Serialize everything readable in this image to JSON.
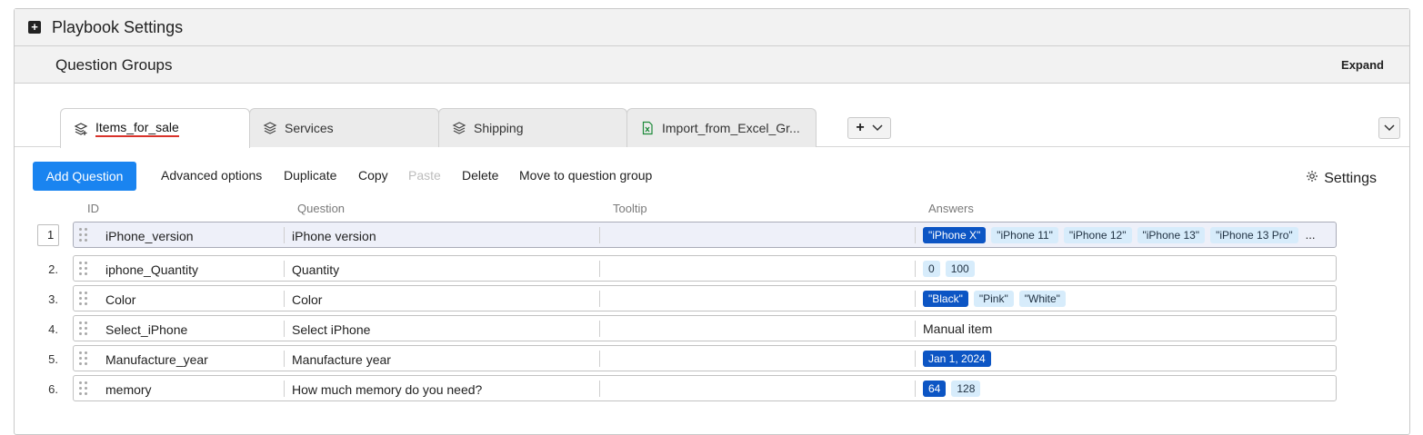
{
  "panel": {
    "title": "Playbook Settings",
    "toggle_glyph": "+"
  },
  "question_groups": {
    "title": "Question Groups",
    "expand_label": "Expand"
  },
  "tabs": [
    {
      "label": "Items_for_sale",
      "icon": "layers-edit-icon",
      "active": true
    },
    {
      "label": "Services",
      "icon": "layers-icon",
      "active": false
    },
    {
      "label": "Shipping",
      "icon": "layers-icon",
      "active": false
    },
    {
      "label": "Import_from_Excel_Gr...",
      "icon": "excel-file-icon",
      "active": false
    }
  ],
  "tab_add": {
    "plus": "+",
    "icon": "chevron-down-icon"
  },
  "toolbar": {
    "add_question": "Add Question",
    "advanced_options": "Advanced options",
    "duplicate": "Duplicate",
    "copy": "Copy",
    "paste": "Paste",
    "delete": "Delete",
    "move": "Move to question group",
    "settings": "Settings"
  },
  "columns": {
    "id": "ID",
    "question": "Question",
    "tooltip": "Tooltip",
    "answers": "Answers"
  },
  "rows": [
    {
      "num": "1",
      "id": "iPhone_version",
      "question": "iPhone version",
      "tooltip": "",
      "answers": [
        "\"iPhone X\"",
        "\"iPhone 11\"",
        "\"iPhone 12\"",
        "\"iPhone 13\"",
        "\"iPhone 13 Pro\""
      ],
      "more": "...",
      "selected": true
    },
    {
      "num": "2.",
      "id": "iphone_Quantity",
      "question": "Quantity",
      "tooltip": "",
      "answers": [
        "0",
        "100"
      ]
    },
    {
      "num": "3.",
      "id": "Color",
      "question": "Color",
      "tooltip": "",
      "answers": [
        "\"Black\"",
        "\"Pink\"",
        "\"White\""
      ]
    },
    {
      "num": "4.",
      "id": "Select_iPhone",
      "question": "Select iPhone",
      "tooltip": "",
      "answer_text": "Manual item"
    },
    {
      "num": "5.",
      "id": "Manufacture_year",
      "question": "Manufacture year",
      "tooltip": "",
      "answers": [
        "Jan 1, 2024"
      ]
    },
    {
      "num": "6.",
      "id": "memory",
      "question": "How much memory do you need?",
      "tooltip": "",
      "answers": [
        "64",
        "128"
      ]
    }
  ],
  "colors": {
    "primary": "#1a84f0",
    "chip_dark": "#0c55c4",
    "chip_light": "#d7ecfb",
    "active_underline": "#d9332b"
  }
}
